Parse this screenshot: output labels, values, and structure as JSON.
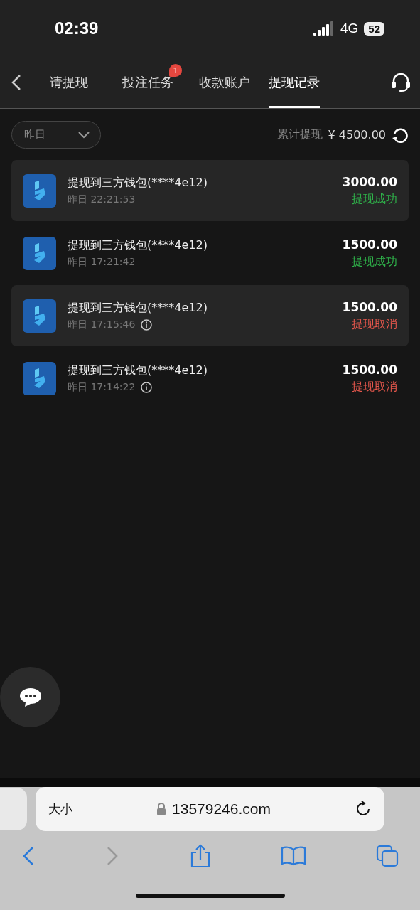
{
  "status_bar": {
    "time": "02:39",
    "network": "4G",
    "battery": "52"
  },
  "tabs": [
    {
      "label": "请提现",
      "selected": false
    },
    {
      "label": "投注任务",
      "selected": false,
      "badge": "1"
    },
    {
      "label": "收款账户",
      "selected": false
    },
    {
      "label": "提现记录",
      "selected": true
    }
  ],
  "filter": {
    "value": "昨日"
  },
  "total": {
    "label": "累计提现",
    "amount": "¥ 4500.00"
  },
  "records": [
    {
      "title": "提现到三方钱包(****4e12)",
      "time": "昨日 22:21:53",
      "info": false,
      "amount": "3000.00",
      "status": "提现成功",
      "kind": "success"
    },
    {
      "title": "提现到三方钱包(****4e12)",
      "time": "昨日 17:21:42",
      "info": false,
      "amount": "1500.00",
      "status": "提现成功",
      "kind": "success"
    },
    {
      "title": "提现到三方钱包(****4e12)",
      "time": "昨日 17:15:46",
      "info": true,
      "amount": "1500.00",
      "status": "提现取消",
      "kind": "cancelled"
    },
    {
      "title": "提现到三方钱包(****4e12)",
      "time": "昨日 17:14:22",
      "info": true,
      "amount": "1500.00",
      "status": "提现取消",
      "kind": "cancelled"
    }
  ],
  "browser": {
    "text_size": "大小",
    "url": "13579246.com"
  }
}
